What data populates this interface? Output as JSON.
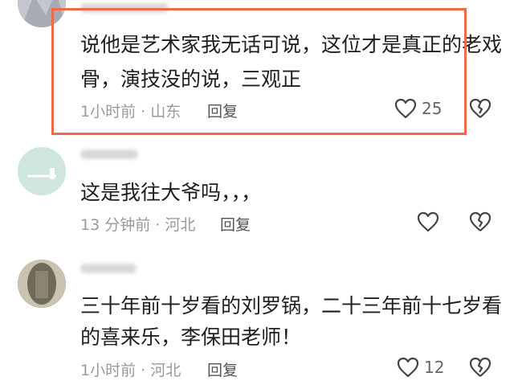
{
  "comments": [
    {
      "line1": "说他是艺术家我无话可说，这位才是真正的老戏",
      "line2": "骨，演技没的说，三观正",
      "time": "1小时前",
      "location": "山东",
      "reply_label": "回复",
      "likes": "25"
    },
    {
      "line1": "这是我往大爷吗，，，",
      "time": "13 分钟前",
      "location": "河北",
      "reply_label": "回复",
      "likes": ""
    },
    {
      "line1": "三十年前十岁看的刘罗锅，二十三年前十七岁看",
      "line2": "的喜来乐，李保田老师！",
      "time": "1小时前",
      "location": "河北",
      "reply_label": "回复",
      "likes": "12"
    }
  ],
  "colors": {
    "highlight_border": "#ef6b47",
    "meta_text": "#9a9a9a",
    "avatar_1": "#b7b9c2",
    "avatar_2": "#cfe6df"
  },
  "icons": {
    "like": "heart-outline-icon",
    "dislike": "broken-heart-icon"
  }
}
